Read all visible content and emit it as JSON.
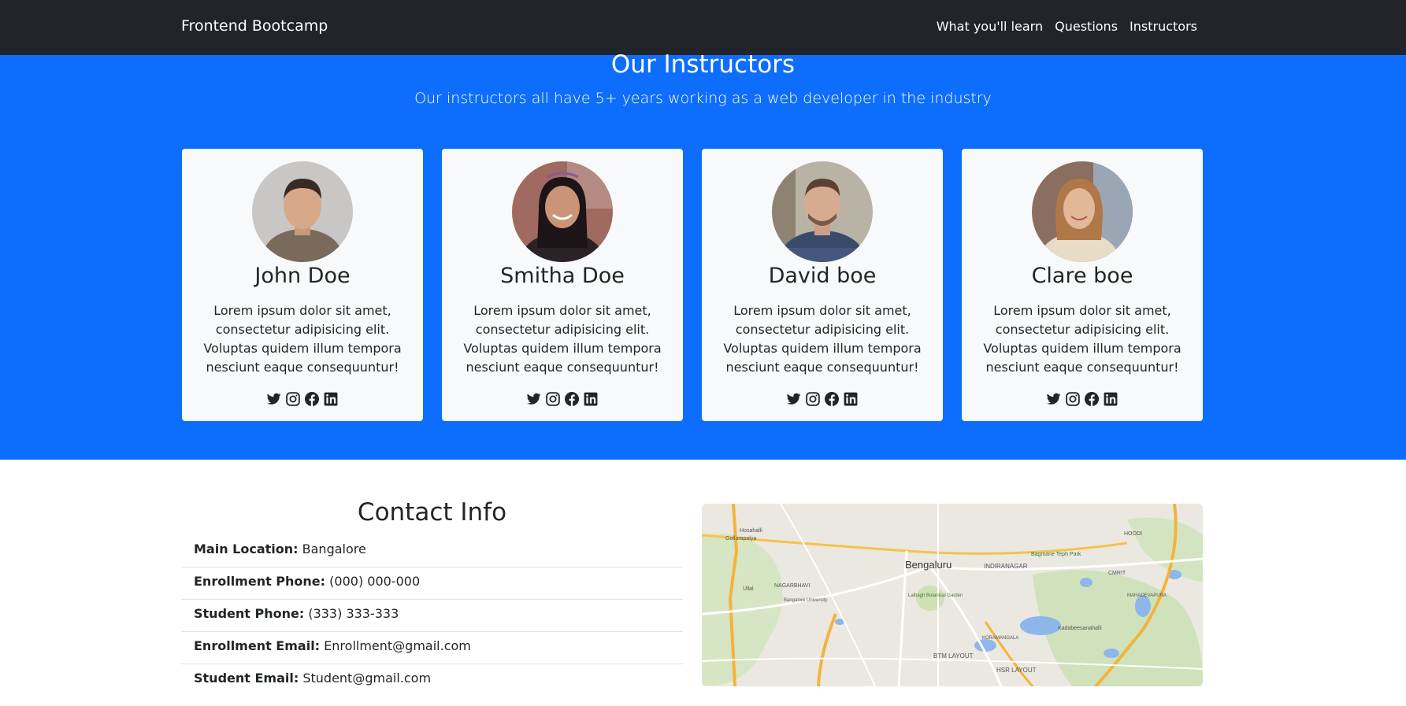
{
  "navbar": {
    "brand": "Frontend Bootcamp",
    "links": [
      "What you'll learn",
      "Questions",
      "Instructors"
    ]
  },
  "instructors": {
    "title": "Our Instructors",
    "subtitle": "Our instructors all have 5+ years working as a web developer in the industry",
    "cards": [
      {
        "name": "John Doe",
        "text": "Lorem ipsum dolor sit amet, consectetur adipisicing elit. Voluptas quidem illum tempora nesciunt eaque consequuntur!"
      },
      {
        "name": "Smitha Doe",
        "text": "Lorem ipsum dolor sit amet, consectetur adipisicing elit. Voluptas quidem illum tempora nesciunt eaque consequuntur!"
      },
      {
        "name": "David boe",
        "text": "Lorem ipsum dolor sit amet, consectetur adipisicing elit. Voluptas quidem illum tempora nesciunt eaque consequuntur!"
      },
      {
        "name": "Clare boe",
        "text": "Lorem ipsum dolor sit amet, consectetur adipisicing elit. Voluptas quidem illum tempora nesciunt eaque consequuntur!"
      }
    ],
    "social_icons": [
      "twitter-icon",
      "instagram-icon",
      "facebook-icon",
      "linkedin-icon"
    ]
  },
  "contact": {
    "title": "Contact Info",
    "items": [
      {
        "label": "Main Location:",
        "value": "Bangalore"
      },
      {
        "label": "Enrollment Phone:",
        "value": "(000) 000-000"
      },
      {
        "label": "Student Phone:",
        "value": "(333) 333-333"
      },
      {
        "label": "Enrollment Email:",
        "value": "Enrollment@gmail.com"
      },
      {
        "label": "Student Email:",
        "value": "Student@gmail.com"
      }
    ]
  },
  "map": {
    "city_label": "Bengaluru",
    "places": [
      "Hosahalli",
      "Gollarapalya",
      "Ullal",
      "NAGARBHAVI",
      "Bangalore University",
      "Lalbagh Botanical Garden",
      "INDIRANAGAR",
      "Bagmane Teph Park",
      "HOODI",
      "CMRIT",
      "Kadabeesanahalli",
      "BTM LAYOUT",
      "HSR LAYOUT",
      "KORAMANGALA",
      "MAHADEVAPURA"
    ]
  },
  "colors": {
    "navbar": "#212529",
    "primary": "#0d6efd",
    "card": "#f8f9fa"
  }
}
